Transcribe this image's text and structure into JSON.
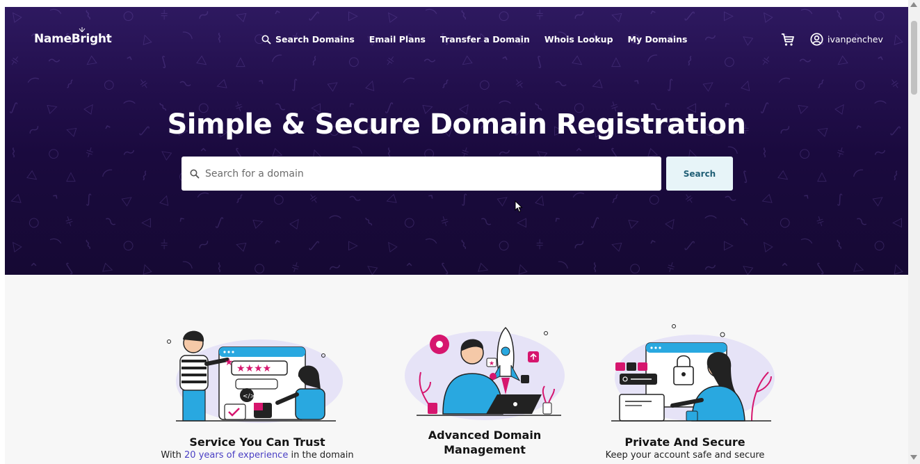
{
  "brand": {
    "name": "NameBright"
  },
  "nav": {
    "items": [
      {
        "label": "Search Domains",
        "icon": "search-icon"
      },
      {
        "label": "Email Plans"
      },
      {
        "label": "Transfer a Domain"
      },
      {
        "label": "Whois Lookup"
      },
      {
        "label": "My Domains"
      }
    ],
    "cart_icon": "cart-icon",
    "username": "ivanpenchev"
  },
  "hero": {
    "title": "Simple & Secure Domain Registration",
    "search_placeholder": "Search for a domain",
    "search_button": "Search"
  },
  "features": [
    {
      "title": "Service You Can Trust",
      "desc_before": "With ",
      "desc_highlight": "20 years of experience",
      "desc_after": " in the domain"
    },
    {
      "title_line1": "Advanced Domain",
      "title_line2": "Management"
    },
    {
      "title": "Private And Secure",
      "desc": "Keep your account safe and secure"
    }
  ],
  "colors": {
    "hero_bg": "#1a0a3e",
    "search_button_bg": "#e7f4f8",
    "highlight": "#4a3fc4",
    "accent_pink": "#d6166e",
    "accent_blue": "#29a8e0",
    "accent_lavender": "#d8d5f3"
  }
}
